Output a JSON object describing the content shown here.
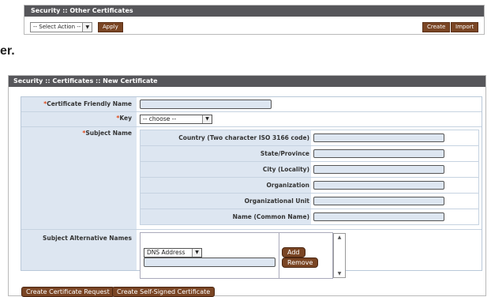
{
  "other_panel": {
    "title": "Security :: Other Certificates",
    "select_action": "-- Select Action --",
    "apply_label": "Apply",
    "create_label": "Create",
    "import_label": "Import"
  },
  "fragment_text": "er.",
  "new_panel": {
    "title": "Security :: Certificates :: New Certificate",
    "required_mark": "*",
    "friendly_name_label": "Certificate Friendly Name",
    "key_label": "Key",
    "key_value": "-- choose --",
    "subject_name_label": "Subject Name",
    "subject_fields": [
      {
        "label": "Country (Two character ISO 3166 code)"
      },
      {
        "label": "State/Province"
      },
      {
        "label": "City (Locality)"
      },
      {
        "label": "Organization"
      },
      {
        "label": "Organizational Unit"
      },
      {
        "label": "Name (Common Name)"
      }
    ],
    "san_label": "Subject Alternative Names",
    "san_type_value": "DNS Address",
    "add_label": "Add",
    "remove_label": "Remove",
    "create_request_label": "Create Certificate Request",
    "create_selfsigned_label": "Create Self-Signed Certificate"
  },
  "icons": {
    "dropdown_arrow": "chevron-down-icon",
    "scroll_up": "scroll-up-icon",
    "scroll_down": "scroll-down-icon"
  },
  "colors": {
    "header_bg": "#56565a",
    "button_bg": "#7a4524",
    "label_bg": "#dde6f1",
    "required": "#e04a1a"
  }
}
